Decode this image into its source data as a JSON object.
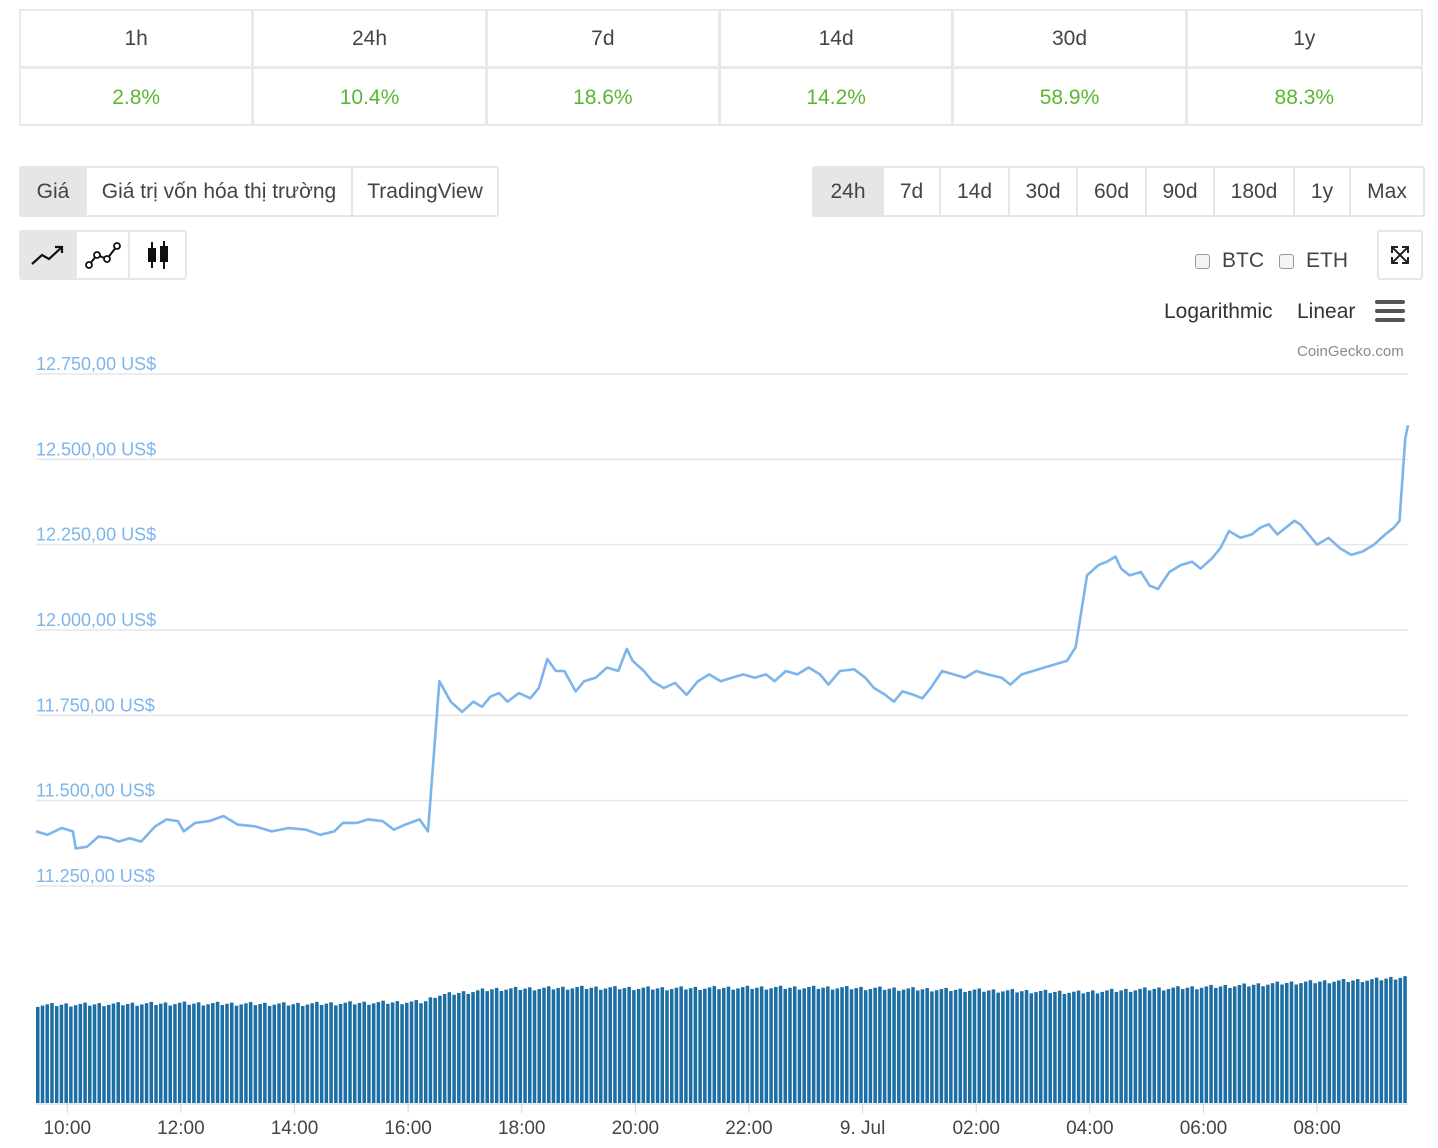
{
  "performance": {
    "periods": [
      "1h",
      "24h",
      "7d",
      "14d",
      "30d",
      "1y"
    ],
    "changes": [
      "2.8%",
      "10.4%",
      "18.6%",
      "14.2%",
      "58.9%",
      "88.3%"
    ]
  },
  "view_tabs": {
    "items": [
      "Giá",
      "Giá trị vốn hóa thị trường",
      "TradingView"
    ],
    "active": "Giá"
  },
  "range_tabs": {
    "items": [
      "24h",
      "7d",
      "14d",
      "30d",
      "60d",
      "90d",
      "180d",
      "1y",
      "Max"
    ],
    "active": "24h"
  },
  "chart_types": [
    "line-chart-icon",
    "line-markers-chart-icon",
    "candlestick-icon"
  ],
  "compare": {
    "btc_label": "BTC",
    "eth_label": "ETH"
  },
  "scale": {
    "log_label": "Logarithmic",
    "linear_label": "Linear"
  },
  "credit": "CoinGecko.com",
  "colors": {
    "line": "#7cb5ec",
    "volume": "#1c6ea4",
    "positive": "#5ab82e",
    "grid": "#e6e6e6"
  },
  "chart_data": {
    "type": "line",
    "ylabel_suffix": " US$",
    "yticks": [
      "12.750,00 US$",
      "12.500,00 US$",
      "12.250,00 US$",
      "12.000,00 US$",
      "11.750,00 US$",
      "11.500,00 US$",
      "11.250,00 US$"
    ],
    "ytick_values": [
      12750,
      12500,
      12250,
      12000,
      11750,
      11500,
      11250
    ],
    "ylim": [
      11250,
      12750
    ],
    "xticks": [
      "10:00",
      "12:00",
      "14:00",
      "16:00",
      "18:00",
      "20:00",
      "22:00",
      "9. Jul",
      "02:00",
      "04:00",
      "06:00",
      "08:00"
    ],
    "xtick_hours": [
      10,
      12,
      14,
      16,
      18,
      20,
      22,
      24,
      26,
      28,
      30,
      32
    ],
    "x_range_hours": [
      9.45,
      33.6
    ],
    "grid": true,
    "legend": "none",
    "series": [
      {
        "points": [
          [
            9.45,
            11410
          ],
          [
            9.65,
            11400
          ],
          [
            9.9,
            11420
          ],
          [
            10.1,
            11410
          ],
          [
            10.15,
            11360
          ],
          [
            10.35,
            11365
          ],
          [
            10.55,
            11395
          ],
          [
            10.75,
            11390
          ],
          [
            10.9,
            11380
          ],
          [
            11.1,
            11390
          ],
          [
            11.3,
            11380
          ],
          [
            11.55,
            11425
          ],
          [
            11.75,
            11445
          ],
          [
            11.95,
            11440
          ],
          [
            12.05,
            11410
          ],
          [
            12.25,
            11435
          ],
          [
            12.5,
            11440
          ],
          [
            12.75,
            11455
          ],
          [
            13.0,
            11430
          ],
          [
            13.3,
            11425
          ],
          [
            13.6,
            11410
          ],
          [
            13.9,
            11420
          ],
          [
            14.2,
            11415
          ],
          [
            14.45,
            11400
          ],
          [
            14.7,
            11410
          ],
          [
            14.85,
            11435
          ],
          [
            15.1,
            11435
          ],
          [
            15.3,
            11445
          ],
          [
            15.55,
            11440
          ],
          [
            15.75,
            11415
          ],
          [
            15.95,
            11430
          ],
          [
            16.2,
            11445
          ],
          [
            16.35,
            11410
          ],
          [
            16.55,
            11850
          ],
          [
            16.75,
            11790
          ],
          [
            16.95,
            11760
          ],
          [
            17.15,
            11790
          ],
          [
            17.3,
            11775
          ],
          [
            17.45,
            11805
          ],
          [
            17.6,
            11815
          ],
          [
            17.75,
            11790
          ],
          [
            17.95,
            11815
          ],
          [
            18.15,
            11800
          ],
          [
            18.3,
            11830
          ],
          [
            18.45,
            11915
          ],
          [
            18.6,
            11880
          ],
          [
            18.75,
            11880
          ],
          [
            18.95,
            11820
          ],
          [
            19.1,
            11850
          ],
          [
            19.3,
            11860
          ],
          [
            19.5,
            11890
          ],
          [
            19.7,
            11880
          ],
          [
            19.85,
            11945
          ],
          [
            19.95,
            11910
          ],
          [
            20.15,
            11880
          ],
          [
            20.3,
            11850
          ],
          [
            20.5,
            11830
          ],
          [
            20.7,
            11845
          ],
          [
            20.9,
            11810
          ],
          [
            21.1,
            11850
          ],
          [
            21.3,
            11870
          ],
          [
            21.5,
            11850
          ],
          [
            21.7,
            11860
          ],
          [
            21.9,
            11870
          ],
          [
            22.1,
            11860
          ],
          [
            22.3,
            11870
          ],
          [
            22.45,
            11850
          ],
          [
            22.65,
            11880
          ],
          [
            22.85,
            11870
          ],
          [
            23.05,
            11890
          ],
          [
            23.25,
            11870
          ],
          [
            23.4,
            11840
          ],
          [
            23.6,
            11880
          ],
          [
            23.85,
            11885
          ],
          [
            24.05,
            11860
          ],
          [
            24.2,
            11830
          ],
          [
            24.4,
            11810
          ],
          [
            24.55,
            11790
          ],
          [
            24.7,
            11820
          ],
          [
            24.9,
            11810
          ],
          [
            25.05,
            11800
          ],
          [
            25.2,
            11830
          ],
          [
            25.4,
            11880
          ],
          [
            25.6,
            11870
          ],
          [
            25.8,
            11860
          ],
          [
            26.0,
            11880
          ],
          [
            26.2,
            11870
          ],
          [
            26.45,
            11860
          ],
          [
            26.6,
            11840
          ],
          [
            26.8,
            11870
          ],
          [
            27.0,
            11880
          ],
          [
            27.2,
            11890
          ],
          [
            27.4,
            11900
          ],
          [
            27.6,
            11910
          ],
          [
            27.75,
            11950
          ],
          [
            27.95,
            12160
          ],
          [
            28.15,
            12190
          ],
          [
            28.3,
            12200
          ],
          [
            28.45,
            12215
          ],
          [
            28.55,
            12180
          ],
          [
            28.7,
            12160
          ],
          [
            28.9,
            12170
          ],
          [
            29.05,
            12130
          ],
          [
            29.2,
            12120
          ],
          [
            29.4,
            12170
          ],
          [
            29.6,
            12190
          ],
          [
            29.8,
            12200
          ],
          [
            29.95,
            12180
          ],
          [
            30.15,
            12210
          ],
          [
            30.3,
            12240
          ],
          [
            30.45,
            12290
          ],
          [
            30.65,
            12270
          ],
          [
            30.85,
            12280
          ],
          [
            31.0,
            12300
          ],
          [
            31.15,
            12310
          ],
          [
            31.3,
            12280
          ],
          [
            31.45,
            12300
          ],
          [
            31.6,
            12320
          ],
          [
            31.7,
            12310
          ],
          [
            31.85,
            12280
          ],
          [
            32.0,
            12250
          ],
          [
            32.2,
            12270
          ],
          [
            32.4,
            12240
          ],
          [
            32.6,
            12220
          ],
          [
            32.8,
            12230
          ],
          [
            33.0,
            12250
          ],
          [
            33.2,
            12280
          ],
          [
            33.35,
            12300
          ],
          [
            33.45,
            12320
          ],
          [
            33.55,
            12560
          ],
          [
            33.6,
            12600
          ]
        ]
      }
    ],
    "volume": {
      "note_relative": "relative volume levels, 0-1",
      "levels": [
        [
          9.45,
          0.62
        ],
        [
          12.0,
          0.63
        ],
        [
          14.0,
          0.625
        ],
        [
          15.5,
          0.635
        ],
        [
          16.3,
          0.64
        ],
        [
          16.5,
          0.68
        ],
        [
          17.5,
          0.72
        ],
        [
          19.0,
          0.73
        ],
        [
          20.5,
          0.725
        ],
        [
          22.0,
          0.73
        ],
        [
          23.5,
          0.73
        ],
        [
          25.0,
          0.72
        ],
        [
          26.5,
          0.71
        ],
        [
          27.8,
          0.7
        ],
        [
          29.0,
          0.72
        ],
        [
          30.5,
          0.74
        ],
        [
          31.5,
          0.76
        ],
        [
          33.0,
          0.78
        ],
        [
          33.6,
          0.8
        ]
      ]
    }
  }
}
